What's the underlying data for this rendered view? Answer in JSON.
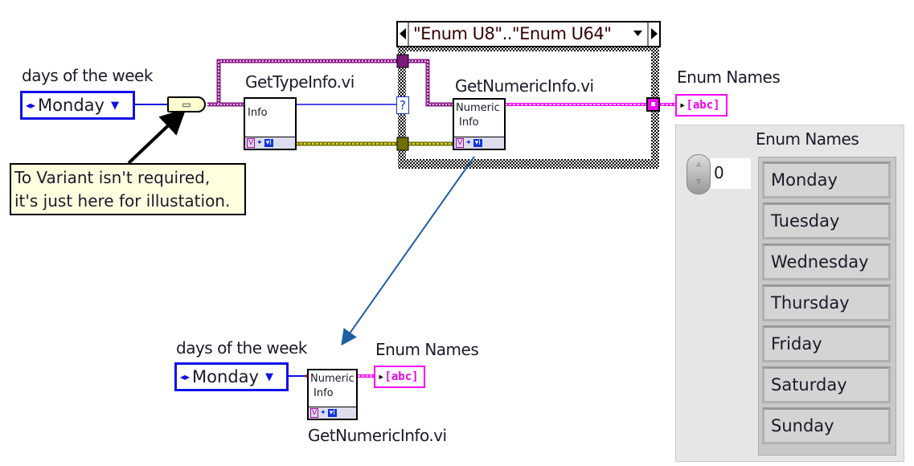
{
  "top": {
    "control_label": "days of the week",
    "control_value": "Monday",
    "comment": [
      "To Variant isn't required,",
      "it's just here for illustation."
    ],
    "get_type_info": {
      "label": "GetTypeInfo.vi",
      "icon_text": "Info"
    },
    "case_selector": "\"Enum U8\"..\"Enum U64\"",
    "case_selector_terminal": "?",
    "get_numeric_info": {
      "label": "GetNumericInfo.vi",
      "icon_text": [
        "Numeric",
        "Info"
      ]
    },
    "indicator_label": "Enum Names",
    "indicator_text": "abc"
  },
  "front_panel": {
    "label": "Enum Names",
    "index": "0",
    "items": [
      "Monday",
      "Tuesday",
      "Wednesday",
      "Thursday",
      "Friday",
      "Saturday",
      "Sunday"
    ]
  },
  "bottom": {
    "control_label": "days of the week",
    "control_value": "Monday",
    "indicator_label": "Enum Names",
    "indicator_text": "abc",
    "node": {
      "label": "GetNumericInfo.vi",
      "icon_text": [
        "Numeric",
        "Info"
      ]
    }
  },
  "colors": {
    "enum": "#1010e8",
    "variant": "#8a1a8a",
    "string": "#ff00ff",
    "cluster": "#808000",
    "arrow": "#1f5fa0"
  }
}
